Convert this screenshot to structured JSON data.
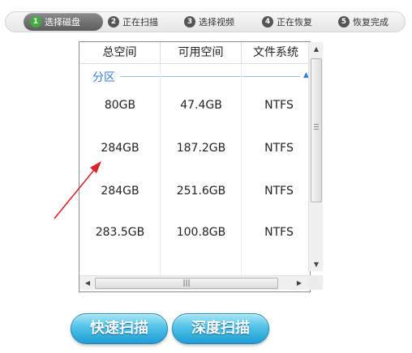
{
  "steps": [
    {
      "num": "1",
      "label": "选择磁盘"
    },
    {
      "num": "2",
      "label": "正在扫描"
    },
    {
      "num": "3",
      "label": "选择视频"
    },
    {
      "num": "4",
      "label": "正在恢复"
    },
    {
      "num": "5",
      "label": "恢复完成"
    }
  ],
  "active_step": 1,
  "table": {
    "headers": [
      "总空间",
      "可用空间",
      "文件系统"
    ],
    "group_label": "分区",
    "rows": [
      {
        "total": "80GB",
        "free": "47.4GB",
        "fs": "NTFS"
      },
      {
        "total": "284GB",
        "free": "187.2GB",
        "fs": "NTFS"
      },
      {
        "total": "284GB",
        "free": "251.6GB",
        "fs": "NTFS"
      },
      {
        "total": "283.5GB",
        "free": "100.8GB",
        "fs": "NTFS"
      }
    ]
  },
  "buttons": {
    "quick_scan": "快速扫描",
    "deep_scan": "深度扫描"
  },
  "colors": {
    "accent_blue": "#3a7bd5",
    "button_blue": "#1f9dd3",
    "active_step_bg": "#5c5c5c",
    "annotation_red": "#d9242a"
  }
}
